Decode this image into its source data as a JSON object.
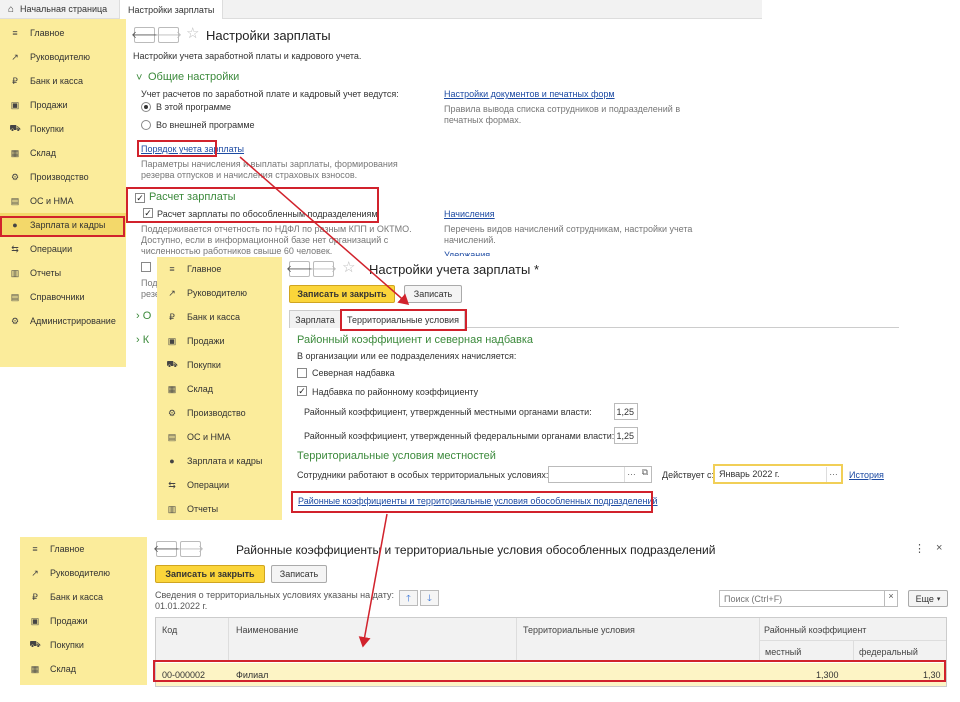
{
  "top_tabs": {
    "home": "Начальная страница",
    "active": "Настройки зарплаты"
  },
  "sidebar1": [
    {
      "icon": "≡",
      "label": "Главное"
    },
    {
      "icon": "↗",
      "label": "Руководителю"
    },
    {
      "icon": "₽",
      "label": "Банк и касса"
    },
    {
      "icon": "▣",
      "label": "Продажи"
    },
    {
      "icon": "⛟",
      "label": "Покупки"
    },
    {
      "icon": "▦",
      "label": "Склад"
    },
    {
      "icon": "⚙",
      "label": "Производство"
    },
    {
      "icon": "▤",
      "label": "ОС и НМА"
    },
    {
      "icon": "●",
      "label": "Зарплата и кадры"
    },
    {
      "icon": "⇆",
      "label": "Операции"
    },
    {
      "icon": "▥",
      "label": "Отчеты"
    },
    {
      "icon": "▤",
      "label": "Справочники"
    },
    {
      "icon": "⚙",
      "label": "Администрирование"
    }
  ],
  "settings": {
    "title": "Настройки зарплаты",
    "subtitle": "Настройки учета заработной платы и кадрового учета.",
    "general_header": "Общие настройки",
    "kept_label": "Учет расчетов по заработной плате и кадровый учет ведутся:",
    "radio_this": "В этой программе",
    "radio_external": "Во внешней программе",
    "docs_link": "Настройки документов и печатных форм",
    "docs_desc1": "Правила вывода списка сотрудников и подразделений в",
    "docs_desc2": "печатных формах.",
    "payroll_link": "Порядок учета зарплаты",
    "payroll_desc1": "Параметры начисления и выплаты зарплаты, формирования",
    "payroll_desc2": "резерва отпусков и начисления страховых взносов.",
    "calc_header": "Расчет зарплаты",
    "calc_separate": "Расчет зарплаты по обособленным подразделениям",
    "calc_desc1": "Поддерживается отчетность по НДФЛ по разным КПП и ОКТМО.",
    "calc_desc2": "Доступно, если в информационной базе нет организаций с",
    "calc_desc3": "численностью работников свыше 60 человек.",
    "accruals_link": "Начисления",
    "accruals_desc1": "Перечень видов начислений сотрудникам, настройки учета",
    "accruals_desc2": "начислений.",
    "hidden_link": "Удержания",
    "left_frag1": "Под",
    "left_frag2": "резе",
    "collapse1": "О",
    "collapse2": "К"
  },
  "sidebar2": [
    {
      "icon": "≡",
      "label": "Главное"
    },
    {
      "icon": "↗",
      "label": "Руководителю"
    },
    {
      "icon": "₽",
      "label": "Банк и касса"
    },
    {
      "icon": "▣",
      "label": "Продажи"
    },
    {
      "icon": "⛟",
      "label": "Покупки"
    },
    {
      "icon": "▦",
      "label": "Склад"
    },
    {
      "icon": "⚙",
      "label": "Производство"
    },
    {
      "icon": "▤",
      "label": "ОС и НМА"
    },
    {
      "icon": "●",
      "label": "Зарплата и кадры"
    },
    {
      "icon": "⇆",
      "label": "Операции"
    },
    {
      "icon": "▥",
      "label": "Отчеты"
    }
  ],
  "dialog2": {
    "title": "Настройки учета зарплаты *",
    "save_close": "Записать и закрыть",
    "save": "Записать",
    "tab_salary": "Зарплата",
    "tab_territorial": "Территориальные условия",
    "rk_header": "Районный коэффициент и северная надбавка",
    "rk_sub": "В организации или ее подразделениях начисляется:",
    "north": "Северная надбавка",
    "bonus": "Надбавка по районному коэффициенту",
    "local_label": "Районный коэффициент, утвержденный местными органами власти:",
    "local_value": "1,25",
    "federal_label": "Районный коэффициент, утвержденный федеральными органами власти:",
    "federal_value": "1,25",
    "terr_header": "Территориальные условия местностей",
    "terr_label": "Сотрудники работают в особых территориальных условиях:",
    "valid_from": "Действует с:",
    "valid_value": "Январь 2022 г.",
    "history": "История",
    "link": "Районные коэффициенты и территориальные условия обособленных подразделений"
  },
  "sidebar3": [
    {
      "icon": "≡",
      "label": "Главное"
    },
    {
      "icon": "↗",
      "label": "Руководителю"
    },
    {
      "icon": "₽",
      "label": "Банк и касса"
    },
    {
      "icon": "▣",
      "label": "Продажи"
    },
    {
      "icon": "⛟",
      "label": "Покупки"
    },
    {
      "icon": "▦",
      "label": "Склад"
    }
  ],
  "dialog3": {
    "title": "Районные коэффициенты и территориальные условия обособленных подразделений",
    "save_close": "Записать и закрыть",
    "save": "Записать",
    "info1": "Сведения о территориальных условиях указаны на дату:",
    "info2": "01.01.2022 г.",
    "search_placeholder": "Поиск (Ctrl+F)",
    "more": "Еще",
    "col_code": "Код",
    "col_name": "Наименование",
    "col_terr": "Территориальные условия",
    "col_rk": "Районный коэффициент",
    "col_local": "местный",
    "col_federal": "федеральный",
    "rows": [
      {
        "code": "00-000002",
        "name": "Филиал",
        "terr": "",
        "local": "1,300",
        "federal": "1,30"
      }
    ]
  }
}
